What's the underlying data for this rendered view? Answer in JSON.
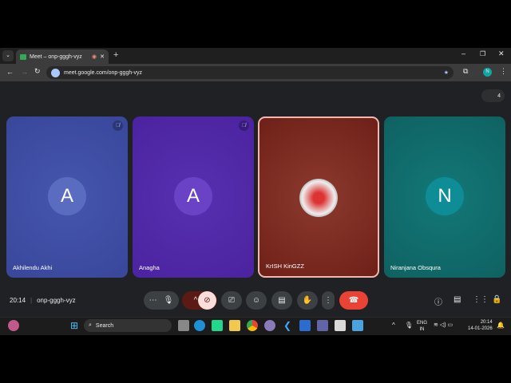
{
  "browser": {
    "tab_title": "Meet – onp-gggh-vyz",
    "url": "meet.google.com/onp-gggh-vyz",
    "profile_initial": "N"
  },
  "meet": {
    "participant_count": "4",
    "tiles": [
      {
        "name": "Akhilendu Akhi",
        "initial": "A",
        "bg": "#38479a",
        "muted": true
      },
      {
        "name": "Anagha",
        "initial": "A",
        "bg": "#4b23a0",
        "muted": true
      },
      {
        "name": "KrISH KinGZZ",
        "initial": "",
        "bg": "#7a2a22",
        "muted": false
      },
      {
        "name": "Niranjana Obsqura",
        "initial": "N",
        "bg": "#0f6e6e",
        "muted": false
      }
    ],
    "time": "20:14",
    "meeting_code": "onp-gggh-vyz"
  },
  "taskbar": {
    "search_placeholder": "Search",
    "lang": "ENG",
    "region": "IN",
    "time": "20:14",
    "date": "14-01-2026"
  }
}
